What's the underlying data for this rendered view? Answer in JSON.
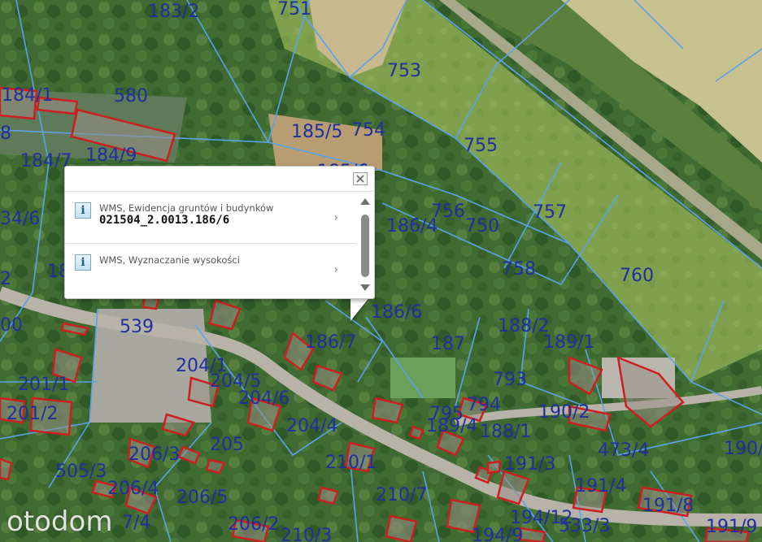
{
  "map": {
    "parcel_labels": [
      "183/2",
      "751",
      "184/1",
      "580",
      "8",
      "184/7",
      "184/9",
      "185/5",
      "754",
      "753",
      "755",
      "756",
      "750",
      "757",
      "186/4",
      "758",
      "760",
      "34/6",
      "186/6",
      "188/2",
      "189/1",
      "539",
      "186/7",
      "187",
      "204/1",
      "204/5",
      "793",
      "201/1",
      "204/6",
      "794",
      "190/2",
      "795",
      "188/1",
      "201/2",
      "204/4",
      "189/4",
      "206/3",
      "205",
      "210/1",
      "473/4",
      "190/",
      "505/3",
      "191/3",
      "206/4",
      "191/4",
      "191/8",
      "210/7",
      "206/5",
      "194/12",
      "533/3",
      "206/2",
      "191/9",
      "194/9",
      "210/3",
      "00",
      "2",
      "18",
      "185/6",
      "7/4"
    ],
    "colors": {
      "parcel_line": "#5aa3e8",
      "building_line": "#cc1f1f",
      "label_text": "#1f2f9c"
    }
  },
  "popup": {
    "close_icon": "close-x-icon",
    "items": [
      {
        "icon": "info-icon",
        "icon_glyph": "i",
        "title": "WMS, Ewidencja gruntów i budynków",
        "value": "021504_2.0013.186/6",
        "chevron": "›"
      },
      {
        "icon": "info-icon",
        "icon_glyph": "i",
        "title": "WMS, Wyznaczanie wysokości",
        "value": "",
        "chevron": "›"
      }
    ]
  },
  "watermark": {
    "text": "otodom"
  }
}
